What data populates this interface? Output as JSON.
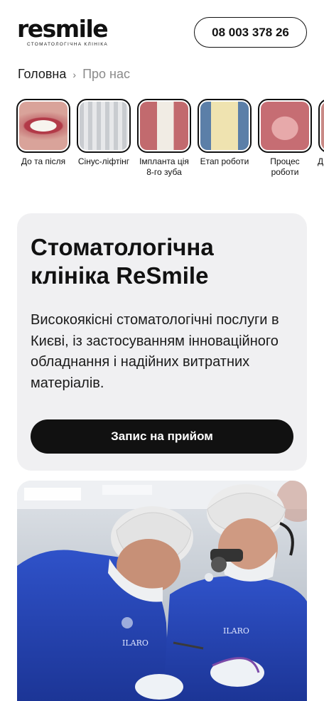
{
  "header": {
    "logo_text": "resmile",
    "logo_subtitle": "стоматологічна клініка",
    "phone": "08 003 378 26"
  },
  "breadcrumb": {
    "home": "Головна",
    "separator": "›",
    "current": "Про нас"
  },
  "stories": [
    {
      "label": "До та після",
      "icon": "smile-teeth-photo"
    },
    {
      "label": "Сінус-ліфтінг",
      "icon": "dental-xray-photo"
    },
    {
      "label": "Імпланта ція 8-го зуба",
      "icon": "implant-closeup-photo"
    },
    {
      "label": "Етап роботи",
      "icon": "crowns-photo"
    },
    {
      "label": "Процес роботи",
      "icon": "upper-jaw-photo"
    },
    {
      "label": "Д",
      "icon": "partial-photo"
    }
  ],
  "hero": {
    "title": "Стоматологічна клініка ReSmile",
    "description": "Високоякісні стоматологічні послуги в Києві, із застосуванням інноваційного обладнання і надійних витратних матеріалів.",
    "cta_label": "Запис на прийом"
  },
  "photo": {
    "badge_text": "ILARO",
    "subject": "two dentists in blue scrubs performing a procedure"
  },
  "colors": {
    "text": "#111111",
    "card_bg": "#f0f0f2",
    "muted": "#8a8a8a",
    "scrubs": "#2646b8"
  }
}
